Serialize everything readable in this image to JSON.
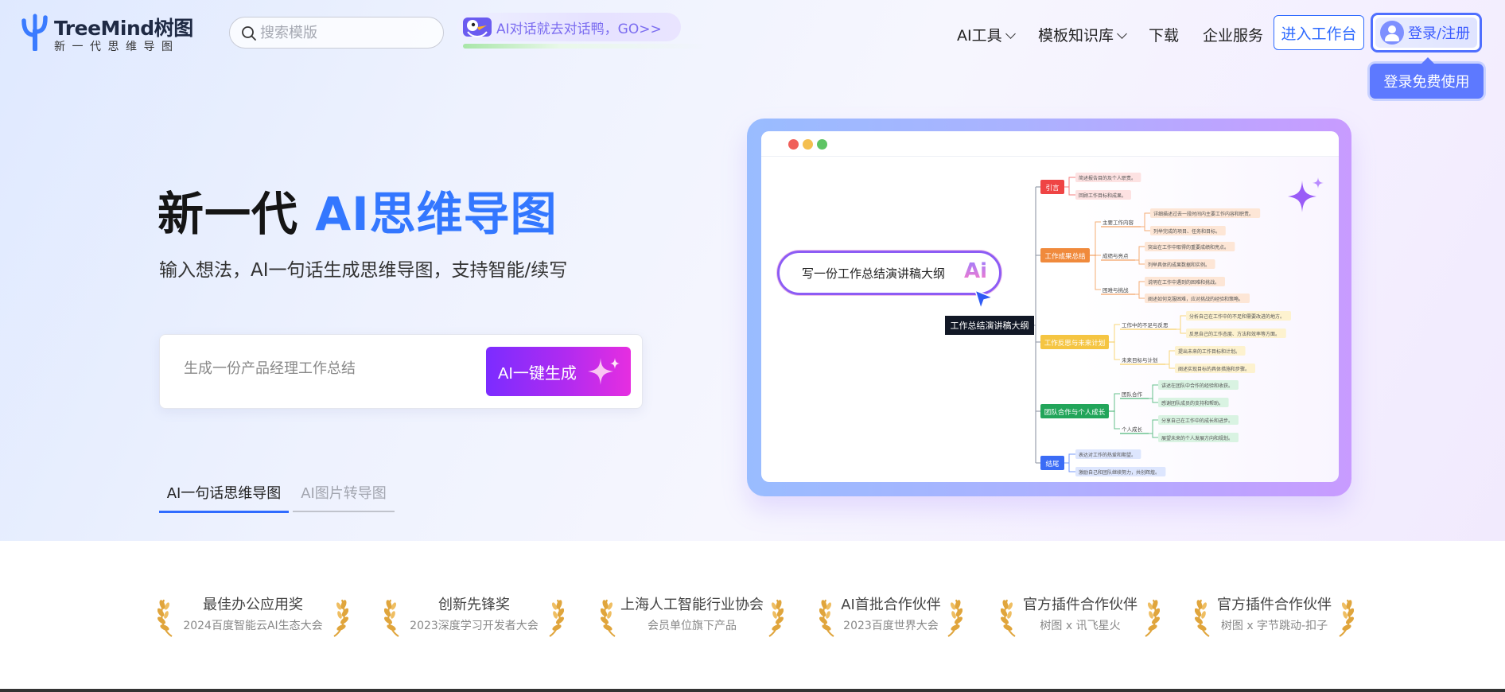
{
  "header": {
    "logo_title": "TreeMind树图",
    "logo_sub": "新一代思维导图",
    "search_placeholder": "搜索模版",
    "promo_text": "AI对话就去对话鸭，GO>>",
    "nav": [
      {
        "label": "AI工具"
      },
      {
        "label": "模板知识库"
      },
      {
        "label": "下载"
      },
      {
        "label": "企业服务"
      }
    ],
    "workbench_label": "进入工作台",
    "login_label": "登录/注册",
    "tooltip": "登录免费使用"
  },
  "hero": {
    "title_dark": "新一代 ",
    "title_blue": "AI思维导图",
    "subtitle": "输入想法，AI一句话生成思维导图，支持智能/续写",
    "input_placeholder": "生成一份产品经理工作总结",
    "generate_label": "AI一键生成",
    "tabs": [
      {
        "label": "AI一句话思维导图",
        "active": true
      },
      {
        "label": "AI图片转导图",
        "active": false
      }
    ]
  },
  "mindmap": {
    "prompt": "写一份工作总结演讲稿大纲",
    "ai_badge": "Ai",
    "root": "工作总结演讲稿大纲",
    "branches": [
      {
        "label": "引言",
        "color": "#ef4444",
        "tint": "#fde2e2"
      },
      {
        "label": "工作成果总结",
        "color": "#f08a3c",
        "tint": "#fde6d6"
      },
      {
        "label": "工作反思与未来计划",
        "color": "#f5c542",
        "tint": "#fdf2cf"
      },
      {
        "label": "团队合作与个人成长",
        "color": "#22a55a",
        "tint": "#d9f3e2"
      },
      {
        "label": "结尾",
        "color": "#3b6cf6",
        "tint": "#dde6fe"
      }
    ],
    "sub_labels": [
      "主要工作内容",
      "成绩与亮点",
      "困难与挑战",
      "工作中的不足与反思",
      "未来目标与计划",
      "团队合作",
      "个人成长"
    ],
    "leaves": [
      "简述报告目的及个人职责。",
      "回顾工作目标和成果。",
      "详细描述过去一段时间内主要工作内容和职责。",
      "列举完成的项目、任务和目标。",
      "突出在工作中取得的重要成绩和亮点。",
      "列举具体的成果数据和实例。",
      "说明在工作中遇到的困难和挑战。",
      "阐述如何克服困难，应对挑战的经验和策略。",
      "分析自己在工作中的不足和需要改进的地方。",
      "反思自己的工作态度、方法和效率等方面。",
      "提出未来的工作目标和计划。",
      "阐述实现目标的具体措施和步骤。",
      "讲述在团队中合作的经验和收获。",
      "感谢团队成员的支持和帮助。",
      "分享自己在工作中的成长和进步。",
      "展望未来的个人发展方向和规划。",
      "表达对工作的热爱和期望。",
      "激励自己和团队继续努力，共创辉煌。"
    ]
  },
  "awards": [
    {
      "title": "最佳办公应用奖",
      "sub": "2024百度智能云AI生态大会"
    },
    {
      "title": "创新先锋奖",
      "sub": "2023深度学习开发者大会"
    },
    {
      "title": "上海人工智能行业协会",
      "sub": "会员单位旗下产品"
    },
    {
      "title": "AI首批合作伙伴",
      "sub": "2023百度世界大会"
    },
    {
      "title": "官方插件合作伙伴",
      "sub": "树图 x 讯飞星火"
    },
    {
      "title": "官方插件合作伙伴",
      "sub": "树图 x 字节跳动-扣子"
    }
  ],
  "colors": {
    "brand_blue": "#2f6bff",
    "hero_blue": "#3377ff",
    "gradient_purple": "#7b2cff",
    "gradient_pink": "#e62ee0",
    "laurel_gold": "#e0a53c"
  }
}
